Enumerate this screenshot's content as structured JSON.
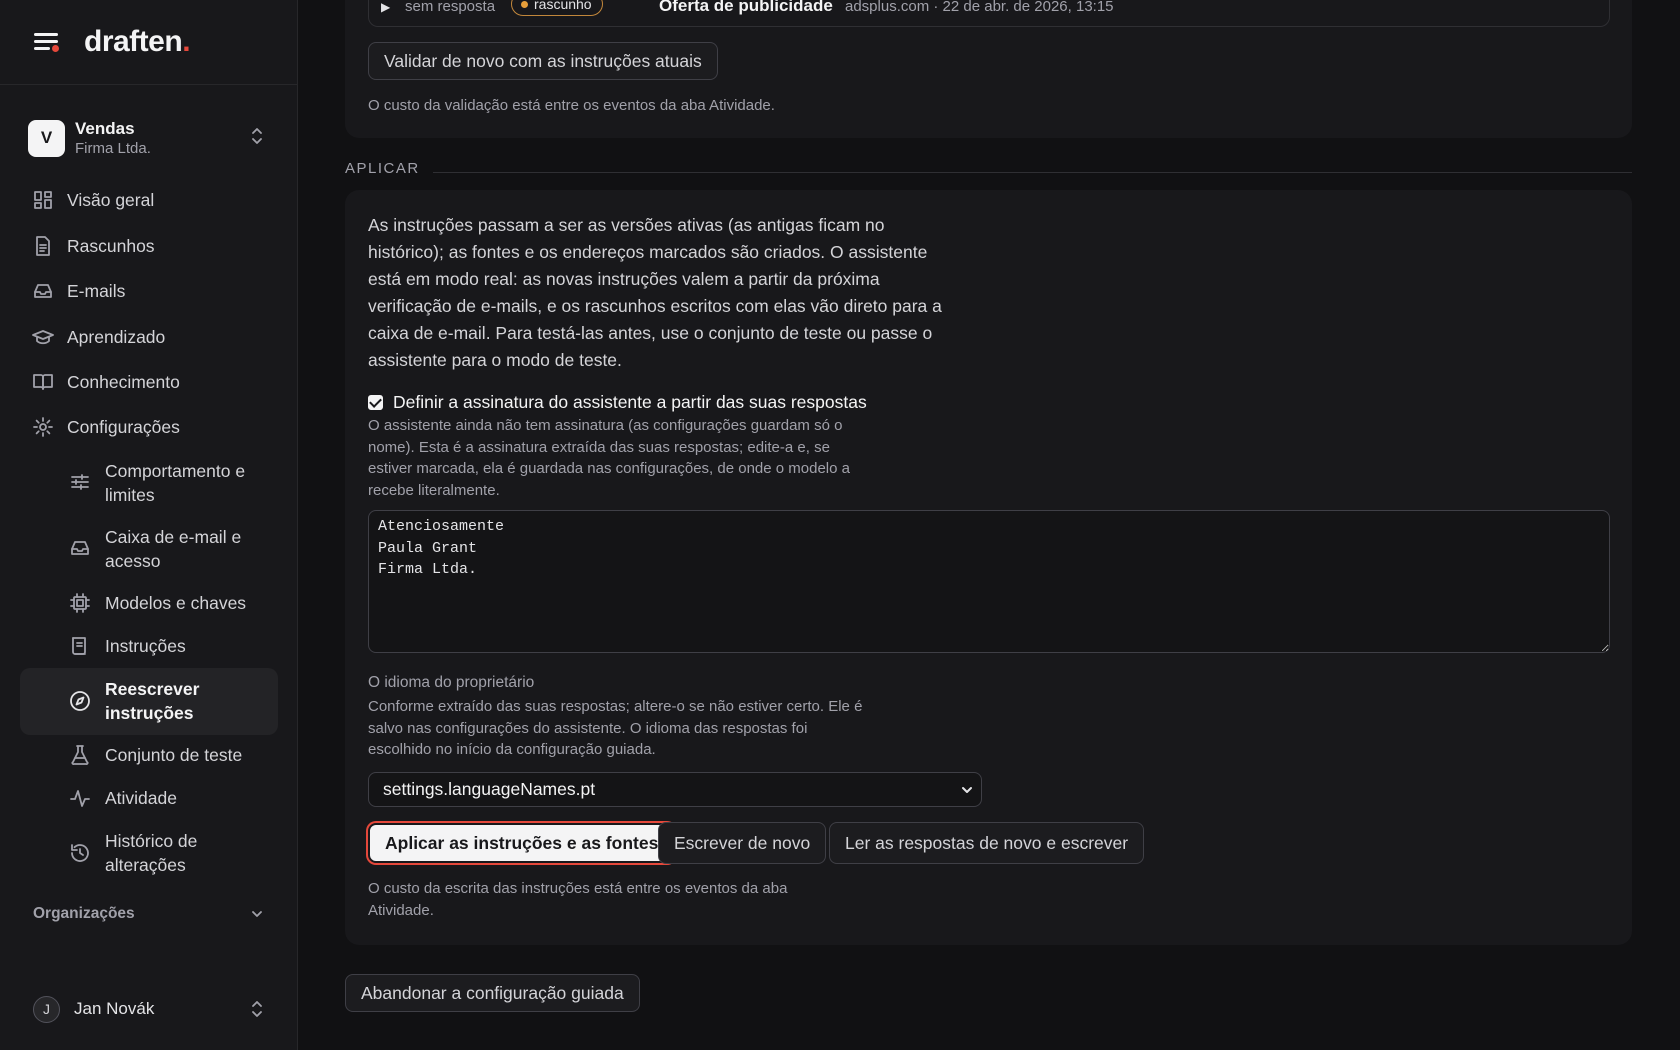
{
  "brand": {
    "name": "draften",
    "dot": "."
  },
  "workspace": {
    "initial": "V",
    "name": "Vendas",
    "company": "Firma Ltda."
  },
  "nav": [
    {
      "label": "Visão geral",
      "icon": "grid-icon"
    },
    {
      "label": "Rascunhos",
      "icon": "document-icon"
    },
    {
      "label": "E-mails",
      "icon": "inbox-icon"
    },
    {
      "label": "Aprendizado",
      "icon": "graduation-cap-icon"
    },
    {
      "label": "Conhecimento",
      "icon": "book-icon"
    },
    {
      "label": "Configurações",
      "icon": "gear-icon"
    }
  ],
  "subnav": [
    {
      "label": "Comportamento e limites",
      "icon": "sliders-icon"
    },
    {
      "label": "Caixa de e-mail e acesso",
      "icon": "inbox-icon"
    },
    {
      "label": "Modelos e chaves",
      "icon": "chip-icon"
    },
    {
      "label": "Instruções",
      "icon": "scroll-icon"
    },
    {
      "label": "Reescrever instruções",
      "icon": "compass-icon",
      "active": true
    },
    {
      "label": "Conjunto de teste",
      "icon": "flask-icon"
    },
    {
      "label": "Atividade",
      "icon": "activity-icon"
    },
    {
      "label": "Histórico de alterações",
      "icon": "history-icon"
    }
  ],
  "organizations_label": "Organizações",
  "user": {
    "initial": "J",
    "name": "Jan Novák"
  },
  "preview_row": {
    "status": "sem resposta",
    "badge": "rascunho",
    "subject": "Oferta de publicidade",
    "meta": "adsplus.com · 22 de abr. de 2026, 13:15"
  },
  "validate": {
    "button": "Validar de novo com as instruções atuais",
    "note": "O custo da validação está entre os eventos da aba Atividade."
  },
  "apply": {
    "section_label": "APLICAR",
    "paragraph": "As instruções passam a ser as versões ativas (as antigas ficam no histórico); as fontes e os endereços marcados são criados. O assistente está em modo real: as novas instruções valem a partir da próxima verificação de e-mails, e os rascunhos escritos com elas vão direto para a caixa de e-mail. Para testá-las antes, use o conjunto de teste ou passe o assistente para o modo de teste.",
    "checkbox_label": "Definir a assinatura do assistente a partir das suas respostas",
    "checkbox_checked": true,
    "signature_help": "O assistente ainda não tem assinatura (as configurações guardam só o nome). Esta é a assinatura extraída das suas respostas; edite-a e, se estiver marcada, ela é guardada nas configurações, de onde o modelo a recebe literalmente.",
    "signature_value": "Atenciosamente\nPaula Grant\nFirma Ltda.",
    "language_label": "O idioma do proprietário",
    "language_help": "Conforme extraído das suas respostas; altere-o se não estiver certo. Ele é salvo nas configurações do assistente. O idioma das respostas foi escolhido no início da configuração guiada.",
    "language_value": "settings.languageNames.pt",
    "apply_button": "Aplicar as instruções e as fontes",
    "rewrite_button": "Escrever de novo",
    "reread_button": "Ler as respostas de novo e escrever",
    "cost_note": "O custo da escrita das instruções está entre os eventos da aba Atividade."
  },
  "abandon_button": "Abandonar a configuração guiada",
  "colors": {
    "accent": "#e5483b",
    "draft_badge": "#e89f3a",
    "background": "#111113",
    "panel": "#18181b"
  }
}
